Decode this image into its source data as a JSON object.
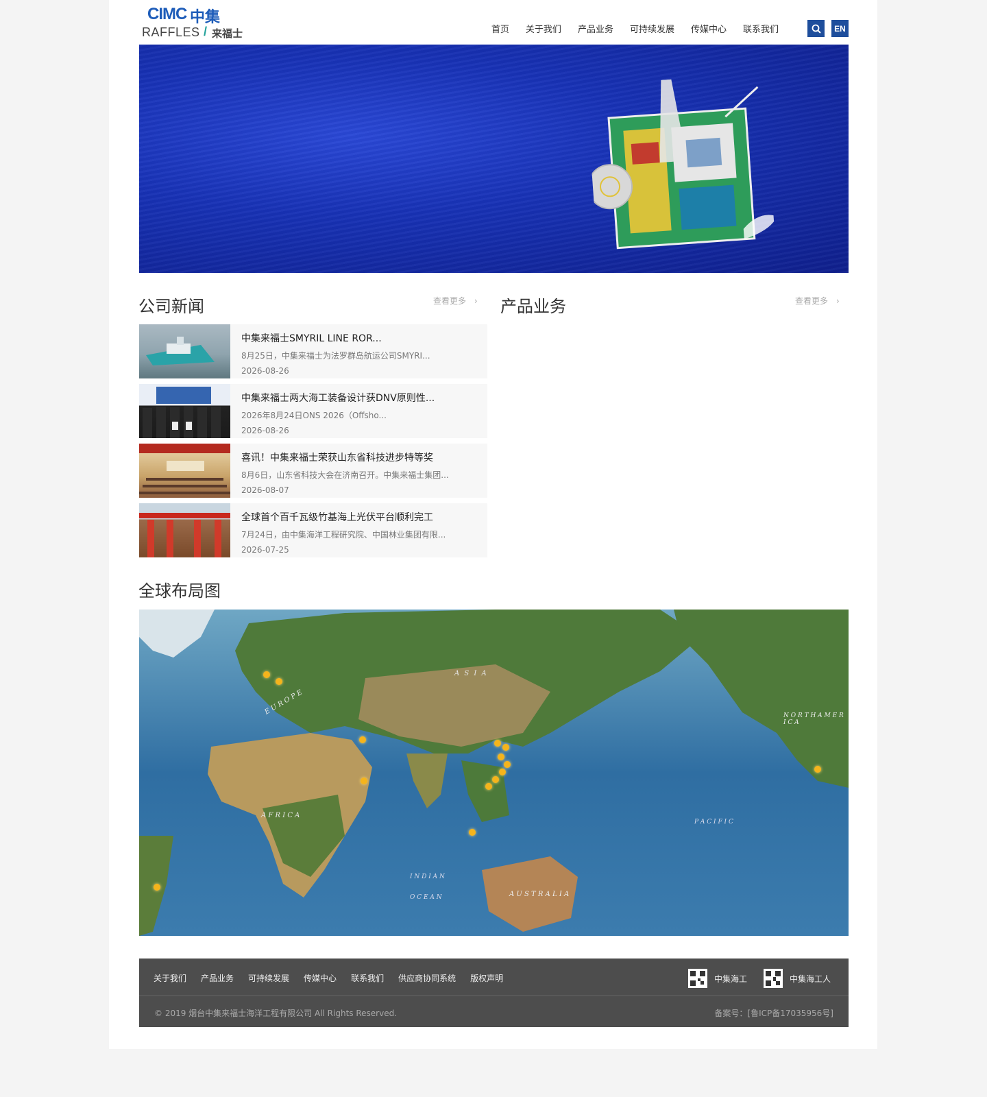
{
  "header": {
    "logo": {
      "cimc": "CIMC",
      "cimc_cn": "中集",
      "raffles": "RAFFLES",
      "slash": "/",
      "raffles_cn": "来福士"
    },
    "nav": [
      "首页",
      "关于我们",
      "产品业务",
      "可持续发展",
      "传媒中心",
      "联系我们"
    ],
    "search_icon": "search-icon",
    "en_label": "EN"
  },
  "news_section": {
    "title": "公司新闻",
    "more": "查看更多",
    "items": [
      {
        "title": "中集来福士SMYRIL LINE ROR...",
        "summary": "8月25日，中集来福士为法罗群岛航运公司SMYRI...",
        "date": "2026-08-26"
      },
      {
        "title": "中集来福士两大海工装备设计获DNV原则性...",
        "summary": "2026年8月24日ONS 2026（Offsho...",
        "date": "2026-08-26"
      },
      {
        "title": "喜讯！中集来福士荣获山东省科技进步特等奖",
        "summary": "8月6日，山东省科技大会在济南召开。中集来福士集团...",
        "date": "2026-08-07"
      },
      {
        "title": "全球首个百千瓦级竹基海上光伏平台顺利完工",
        "summary": "7月24日，由中集海洋工程研究院、中国林业集团有限...",
        "date": "2026-07-25"
      }
    ]
  },
  "product_section": {
    "title": "产品业务",
    "more": "查看更多"
  },
  "map_section": {
    "title": "全球布局图",
    "labels": {
      "asia": "A S I A",
      "europe": "E U R O P E",
      "africa": "A F R I C A",
      "australia": "A U S T R A L I A",
      "north_america": "N O R T H  A M E R I C A",
      "pacific": "P A C I F I C",
      "indian": "I N D I A N",
      "ocean": "O C E A N"
    }
  },
  "footer": {
    "links": [
      "关于我们",
      "产品业务",
      "可持续发展",
      "传媒中心",
      "联系我们",
      "供应商协同系统",
      "版权声明"
    ],
    "social": [
      "中集海工",
      "中集海工人"
    ],
    "copyright": "© 2019 烟台中集来福士海洋工程有限公司 All Rights Reserved.",
    "icp": "备案号：[鲁ICP备17035956号]"
  },
  "colors": {
    "brand_blue": "#1e4e9c",
    "footer_bg": "#4d4d4d",
    "dot": "#f5b41c"
  }
}
